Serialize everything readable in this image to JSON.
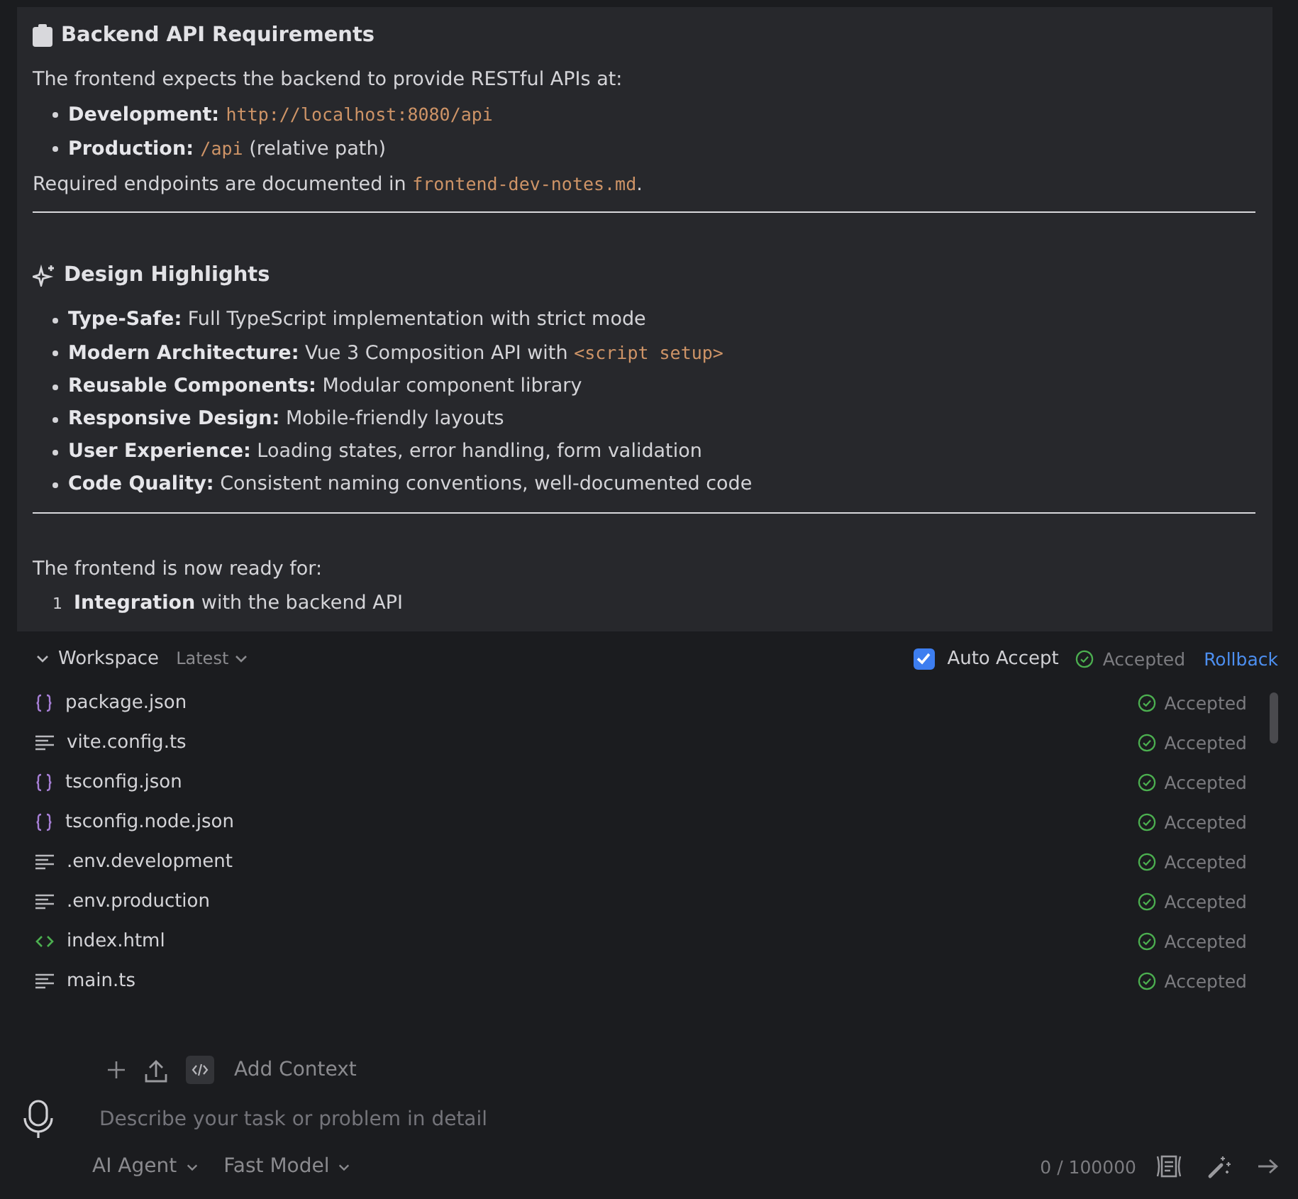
{
  "message": {
    "blocks": [
      {
        "kind": "heading",
        "text": "Backend API Requirements"
      },
      {
        "kind": "para",
        "segments": [
          {
            "kind": "text",
            "text": "The frontend expects the backend to provide RESTful APIs at:"
          }
        ]
      },
      {
        "kind": "bullets",
        "items": [
          [
            {
              "kind": "bold",
              "text": "Development: "
            },
            {
              "kind": "code",
              "text": "http://localhost:8080/api"
            }
          ],
          [
            {
              "kind": "bold",
              "text": "Production: "
            },
            {
              "kind": "code",
              "text": "/api"
            },
            {
              "kind": "text",
              "text": " (relative path)"
            }
          ]
        ]
      },
      {
        "kind": "para",
        "segments": [
          {
            "kind": "text",
            "text": "Required endpoints are documented in "
          },
          {
            "kind": "code",
            "text": "frontend-dev-notes.md"
          },
          {
            "kind": "text",
            "text": "."
          }
        ]
      },
      {
        "kind": "rule"
      },
      {
        "kind": "heading",
        "text": "Design Highlights"
      },
      {
        "kind": "bullets",
        "items": [
          [
            {
              "kind": "bold",
              "text": "Type-Safe:"
            },
            {
              "kind": "text",
              "text": " Full TypeScript implementation with strict mode"
            }
          ],
          [
            {
              "kind": "bold",
              "text": "Modern Architecture:"
            },
            {
              "kind": "text",
              "text": " Vue 3 Composition API with "
            },
            {
              "kind": "code",
              "text": "<script setup>"
            }
          ],
          [
            {
              "kind": "bold",
              "text": "Reusable Components:"
            },
            {
              "kind": "text",
              "text": " Modular component library"
            }
          ],
          [
            {
              "kind": "bold",
              "text": "Responsive Design:"
            },
            {
              "kind": "text",
              "text": " Mobile-friendly layouts"
            }
          ],
          [
            {
              "kind": "bold",
              "text": "User Experience:"
            },
            {
              "kind": "text",
              "text": " Loading states, error handling, form validation"
            }
          ],
          [
            {
              "kind": "bold",
              "text": "Code Quality:"
            },
            {
              "kind": "text",
              "text": " Consistent naming conventions, well-documented code"
            }
          ]
        ]
      },
      {
        "kind": "rule"
      },
      {
        "kind": "para",
        "segments": [
          {
            "kind": "text",
            "text": "The frontend is now ready for:"
          }
        ]
      },
      {
        "kind": "numbered",
        "items": [
          {
            "number": "1",
            "segments": [
              {
                "kind": "bold",
                "text": "Integration"
              },
              {
                "kind": "text",
                "text": " with the backend API"
              }
            ]
          }
        ]
      }
    ]
  },
  "workspace": {
    "title": "Workspace",
    "expanded": true,
    "version": "Latest",
    "auto_accept": {
      "label": "Auto Accept",
      "checked": true
    },
    "status": "Accepted",
    "rollback": "Rollback",
    "files": [
      {
        "kind": "json",
        "name": "package.json",
        "status": "Accepted"
      },
      {
        "kind": "text",
        "name": "vite.config.ts",
        "status": "Accepted"
      },
      {
        "kind": "json",
        "name": "tsconfig.json",
        "status": "Accepted"
      },
      {
        "kind": "json",
        "name": "tsconfig.node.json",
        "status": "Accepted"
      },
      {
        "kind": "text",
        "name": ".env.development",
        "status": "Accepted"
      },
      {
        "kind": "text",
        "name": ".env.production",
        "status": "Accepted"
      },
      {
        "kind": "html",
        "name": "index.html",
        "status": "Accepted"
      },
      {
        "kind": "text",
        "name": "main.ts",
        "status": "Accepted"
      }
    ]
  },
  "composer": {
    "add_context": "Add Context",
    "placeholder": "Describe your task or problem in detail",
    "mode": "AI Agent",
    "model": "Fast Model",
    "counter": "0 / 100000"
  }
}
